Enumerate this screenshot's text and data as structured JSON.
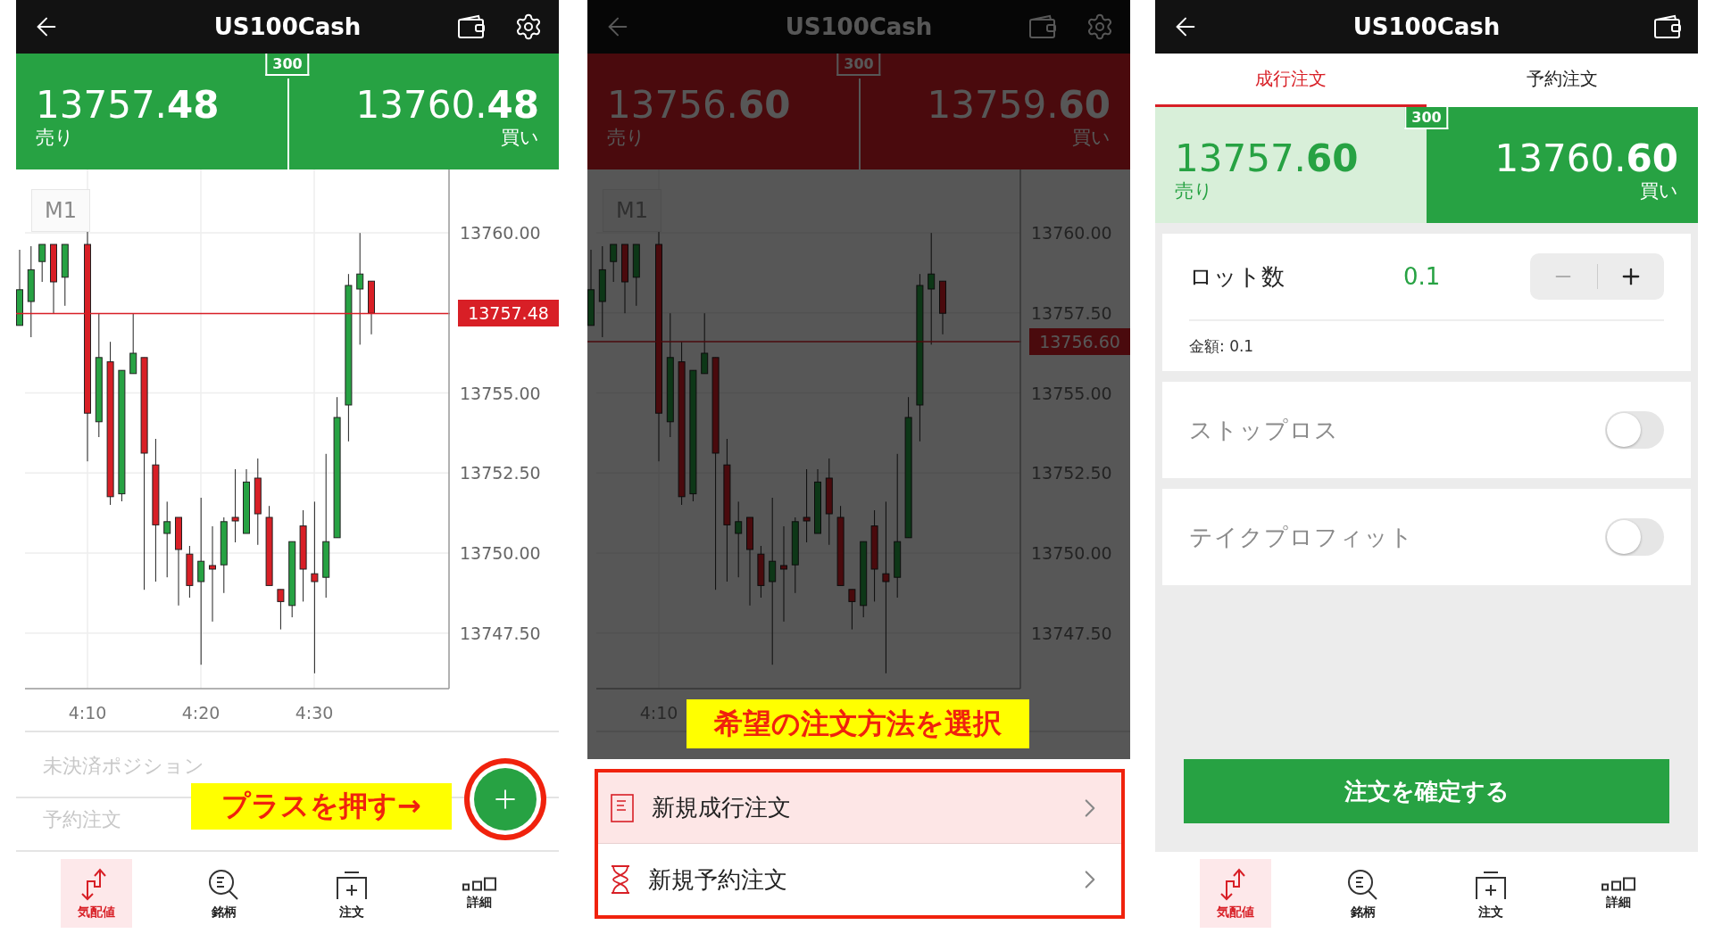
{
  "panels": [
    {
      "kind": "chart",
      "header": {
        "title": "US100Cash",
        "settings": true
      },
      "quote": {
        "falling": false,
        "spread": "300",
        "sell": {
          "price": "13757.**48**",
          "label": "売り"
        },
        "buy": {
          "price": "13760.**48**",
          "label": "買い"
        }
      },
      "chart": {
        "timeframe": "M1",
        "y_labels": [
          "13760.00",
          "13755.00",
          "13752.50",
          "13750.00",
          "13747.50"
        ],
        "x_labels": [
          "4:10",
          "4:20",
          "4:30"
        ],
        "price_marker": "13757.48"
      },
      "lists": [
        "未決済ポジション",
        "予約注文"
      ],
      "add_button": {
        "highlighted": true
      },
      "annotation": "プラスを押す→",
      "nav": [
        {
          "label": "気配値",
          "kind": "quotes",
          "selected": true
        },
        {
          "label": "銘柄",
          "kind": "symbols",
          "selected": false
        },
        {
          "label": "注文",
          "kind": "order",
          "selected": false
        },
        {
          "label": "詳細",
          "kind": "details",
          "selected": false
        }
      ]
    },
    {
      "kind": "chart",
      "dimmed": true,
      "header": {
        "title": "US100Cash",
        "settings": true
      },
      "quote": {
        "falling": true,
        "spread": "300",
        "sell": {
          "price": "13756.**60**",
          "label": "売り"
        },
        "buy": {
          "price": "13759.**60**",
          "label": "買い"
        }
      },
      "chart": {
        "timeframe": "M1",
        "y_labels": [
          "13760.00",
          "13757.50",
          "13755.00",
          "13752.50",
          "13750.00",
          "13747.50"
        ],
        "x_labels": [
          "4:10"
        ],
        "price_marker": "13756.60"
      },
      "annotation": "希望の注文方法を選択",
      "menu": [
        {
          "label": "新規成行注文",
          "kind": "market",
          "selected": true
        },
        {
          "label": "新規予約注文",
          "kind": "pending",
          "selected": false
        }
      ]
    },
    {
      "kind": "order",
      "header": {
        "title": "US100Cash",
        "settings": false
      },
      "tabs": [
        {
          "label": "成行注文",
          "selected": true
        },
        {
          "label": "予約注文",
          "selected": false
        }
      ],
      "quote": {
        "falling": false,
        "spread": "300",
        "sell": {
          "price": "13757.**60**",
          "label": "売り",
          "selected": false
        },
        "buy": {
          "price": "13760.**60**",
          "label": "買い",
          "selected": true
        }
      },
      "lot": {
        "label": "ロット数",
        "value": "0.1",
        "amount": "金額: 0.1"
      },
      "toggles": [
        {
          "label": "ストップロス",
          "on": false
        },
        {
          "label": "テイクプロフィット",
          "on": false
        }
      ],
      "confirm": "注文を確定する",
      "nav": [
        {
          "label": "気配値",
          "kind": "quotes",
          "selected": true
        },
        {
          "label": "銘柄",
          "kind": "symbols",
          "selected": false
        },
        {
          "label": "注文",
          "kind": "order",
          "selected": false
        },
        {
          "label": "詳細",
          "kind": "details",
          "selected": false
        }
      ]
    }
  ]
}
